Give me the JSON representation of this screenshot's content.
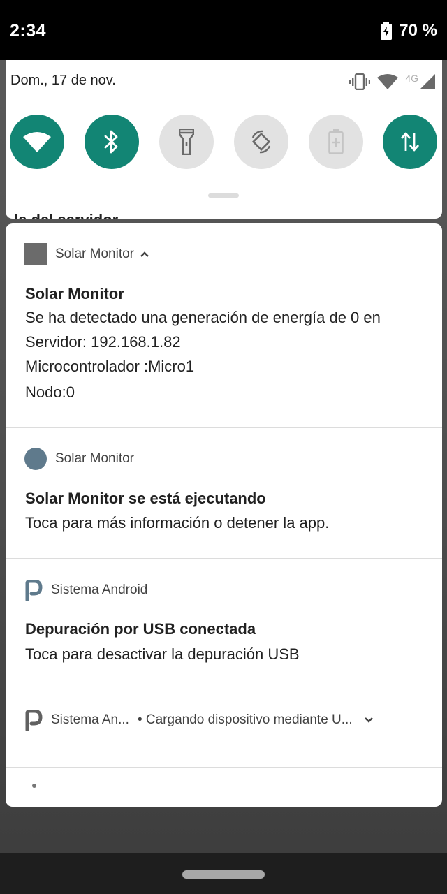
{
  "status_bar": {
    "time": "2:34",
    "battery": "70 %"
  },
  "quick_settings": {
    "date": "Dom., 17 de nov.",
    "network_type": "4G",
    "tiles": [
      {
        "name": "wifi",
        "active": true
      },
      {
        "name": "bluetooth",
        "active": true
      },
      {
        "name": "flashlight",
        "active": false
      },
      {
        "name": "auto-rotate",
        "active": false
      },
      {
        "name": "battery-saver",
        "active": false
      },
      {
        "name": "mobile-data",
        "active": true
      }
    ],
    "accent_color": "#128574"
  },
  "peek_text": "le del servidor",
  "notifications": [
    {
      "app": "Solar Monitor",
      "title": "Solar Monitor",
      "lines": [
        "Se ha detectado una generación de energía de 0 en",
        "Servidor: 192.168.1.82",
        "Microcontrolador :Micro1",
        "Nodo:0"
      ]
    },
    {
      "app": "Solar Monitor",
      "title": "Solar Monitor se está ejecutando",
      "lines": [
        "Toca para más información o detener la app."
      ]
    },
    {
      "app": "Sistema Android",
      "title": "Depuración por USB conectada",
      "lines": [
        "Toca para desactivar la depuración USB"
      ]
    },
    {
      "app": "Sistema An...",
      "summary": "• Cargando dispositivo mediante U..."
    }
  ]
}
